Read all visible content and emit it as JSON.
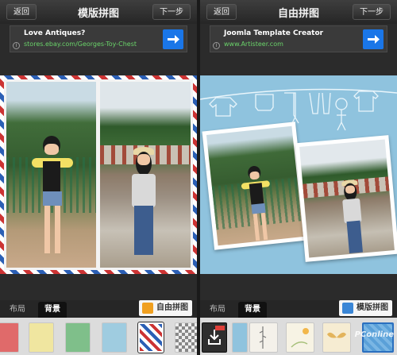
{
  "left_screen": {
    "header": {
      "back_label": "返回",
      "title": "模版拼图",
      "next_label": "下一步"
    },
    "ad": {
      "title": "Love Antiques?",
      "url": "stores.ebay.com/Georges-Toy-Chest",
      "info": "i"
    },
    "tabs": [
      {
        "label": "布局"
      },
      {
        "label": "背景"
      }
    ],
    "mode_button": {
      "label": "自由拼图",
      "icon": "puzzle-icon"
    },
    "swatches": [
      "#e06a6a",
      "#f0e6a0",
      "#7fbf8a",
      "#9fcce0",
      "airmail-stripes",
      "checker-grey"
    ]
  },
  "right_screen": {
    "header": {
      "back_label": "返回",
      "title": "自由拼图",
      "next_label": "下一步"
    },
    "ad": {
      "title": "Joomla Template Creator",
      "url": "www.Artisteer.com",
      "info": "i"
    },
    "tabs": [
      {
        "label": "布局"
      },
      {
        "label": "背景"
      }
    ],
    "mode_button": {
      "label": "模版拼图",
      "icon": "template-icon"
    },
    "swatches": [
      "download-tile",
      "laundry-tile",
      "bamboo-tile",
      "flower-tile",
      "butterfly-tile",
      "blue-pattern-tile"
    ]
  },
  "watermark": "PConline"
}
